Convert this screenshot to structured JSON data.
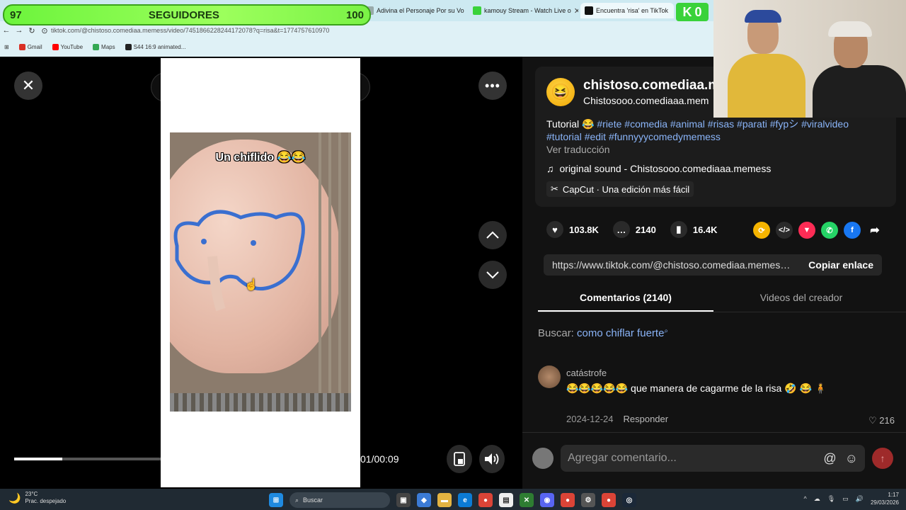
{
  "browser": {
    "tabs": [
      {
        "label": "Adivina el Personaje Por su Vo",
        "icon": "tab-page-icon",
        "color": "#9aa"
      },
      {
        "label": "kamouy Stream - Watch Live o",
        "icon": "kick-icon",
        "color": "#3ad23a"
      },
      {
        "label": "Encuentra 'risa' en TikTok",
        "icon": "tiktok-icon",
        "color": "#111111"
      }
    ],
    "url": "tiktok.com/@chistoso.comediaa.memess/video/7451866228244172078?q=risa&t=1774757610970",
    "bookmarks": [
      {
        "label": "Gmail",
        "icon": "gmail-icon",
        "color": "#d93025"
      },
      {
        "label": "YouTube",
        "icon": "youtube-icon",
        "color": "#ff0000"
      },
      {
        "label": "Maps",
        "icon": "maps-icon",
        "color": "#34a853"
      },
      {
        "label": "S44 16:9 animated...",
        "icon": "s-icon",
        "color": "#222222"
      }
    ]
  },
  "overlay": {
    "followers_current": "97",
    "followers_label": "SEGUIDORES",
    "followers_goal": "100",
    "kick_letter": "K",
    "kick_count": "0"
  },
  "player": {
    "search_value": "como chiflar fuerte",
    "video_caption": "Un chiflido 😂😂",
    "time": "01/00:09",
    "progress": 0.33
  },
  "details": {
    "username": "chistoso.comediaa.m",
    "handle": "Chistosooo.comediaaa.mem",
    "desc_text": "Tutorial 😂",
    "desc_tags": "#riete #comedia #animal #risas #parati #fypシ #viralvideo #tutorial #edit #funnyyycomedymemess",
    "translate": "Ver traducción",
    "sound": "original sound - Chistosooo.comediaaa.memess",
    "capcut": "CapCut · Una edición más fácil",
    "likes": "103.8K",
    "comments": "2140",
    "saves": "16.4K",
    "link": "https://www.tiktok.com/@chistoso.comediaa.memess/video/7451866228244172078",
    "copy_label": "Copiar enlace",
    "tab_comments": "Comentarios (2140)",
    "tab_creator": "Videos del creador",
    "search_prefix": "Buscar:",
    "search_query": "como chiflar fuerte"
  },
  "comment": {
    "user": "catástrofe",
    "text": "😂😂😂😂😂 que manera de cagarme de la risa 🤣 😂 🧍",
    "date": "2024-12-24",
    "reply": "Responder",
    "likes": "216"
  },
  "composer": {
    "placeholder": "Agregar comentario..."
  },
  "taskbar": {
    "temp": "23°C",
    "weather": "Prac. despejado",
    "search": "Buscar",
    "time": "1:17",
    "date": "29/03/2026"
  }
}
